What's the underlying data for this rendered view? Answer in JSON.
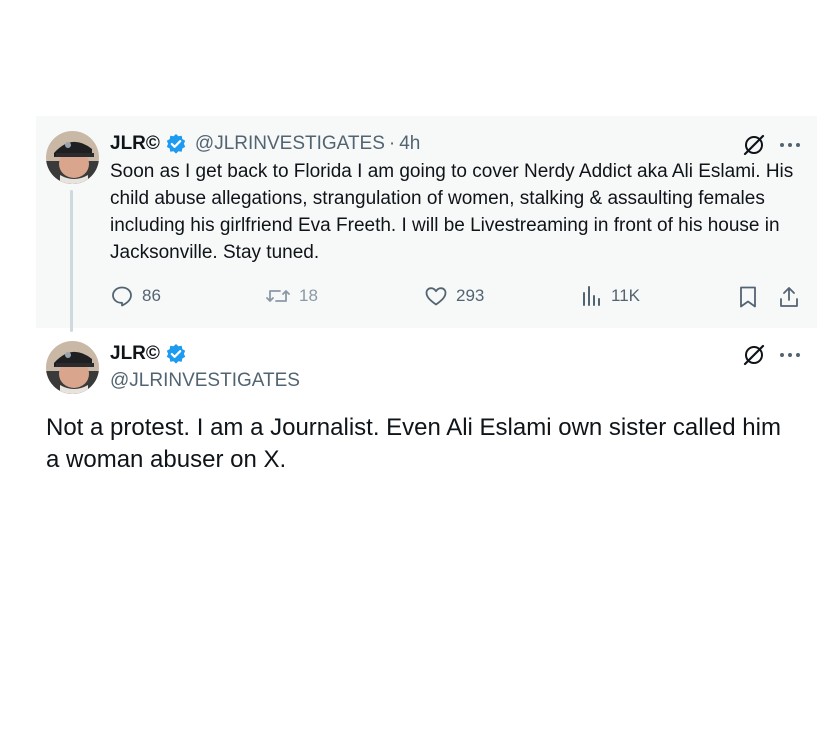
{
  "colors": {
    "verified": "#1d9bf0",
    "muted": "#536471",
    "text": "#0f1419",
    "thread_bg": "#f7f9f9"
  },
  "original_tweet": {
    "name": "JLR©",
    "handle": "@JLRINVESTIGATES",
    "separator": "·",
    "time": "4h",
    "text": "Soon as I get back to Florida I am going to cover Nerdy Addict aka Ali Eslami. His child abuse allegations, strangulation of women, stalking & assaulting females including his girlfriend Eva Freeth. I will be Livestreaming in front of his house in Jacksonville. Stay tuned.",
    "replies": "86",
    "reposts": "18",
    "likes": "293",
    "views": "11K",
    "icons": [
      "verified-badge-icon",
      "grok-icon",
      "more-icon",
      "reply-icon",
      "repost-icon",
      "like-icon",
      "views-icon",
      "bookmark-icon",
      "share-icon"
    ]
  },
  "reply_tweet": {
    "name": "JLR©",
    "handle": "@JLRINVESTIGATES",
    "text": "Not a protest. I am a Journalist. Even Ali Eslami own sister called him a woman abuser on X.",
    "icons": [
      "verified-badge-icon",
      "grok-icon",
      "more-icon"
    ]
  }
}
